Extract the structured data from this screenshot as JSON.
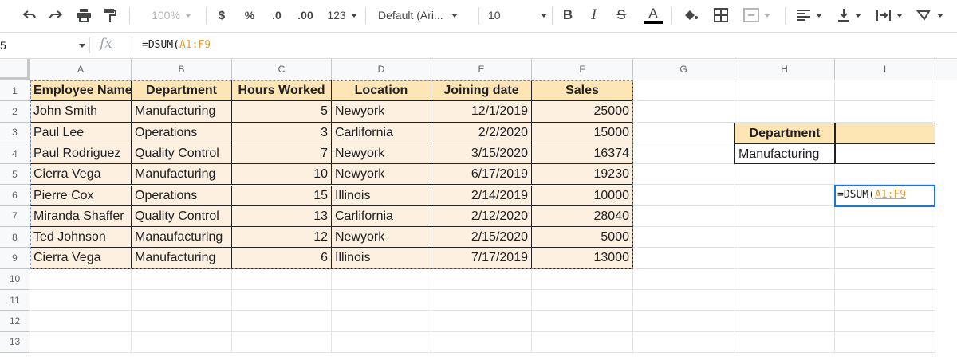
{
  "toolbar": {
    "undo_icon": "undo-icon",
    "redo_icon": "redo-icon",
    "print_icon": "print-icon",
    "paint_format_icon": "paint-format-icon",
    "zoom": "100%",
    "currency": "$",
    "percent": "%",
    "decrease_decimal": ".0",
    "increase_decimal": ".00",
    "more_formats": "123",
    "font_family": "Default (Ari...",
    "font_size": "10",
    "bold": "B",
    "italic": "I",
    "strikethrough": "S",
    "text_color": "A",
    "text_color_value": "#000000",
    "fill_color_icon": "fill-color-icon",
    "borders_icon": "borders-icon",
    "merge_icon": "merge-cells-icon",
    "align_icon": "horizontal-align-icon",
    "valign_icon": "vertical-align-icon",
    "wrap_icon": "text-wrap-icon",
    "rotate_icon": "text-rotation-icon"
  },
  "formula_bar": {
    "name_box": "5",
    "fx": "fx",
    "formula_prefix": "=DSUM(",
    "formula_ref": "A1:F9"
  },
  "columns": [
    "A",
    "B",
    "C",
    "D",
    "E",
    "F",
    "G",
    "H",
    "I"
  ],
  "rows": [
    "1",
    "2",
    "3",
    "4",
    "5",
    "6",
    "7",
    "8",
    "9",
    "10",
    "11",
    "12",
    "13"
  ],
  "table": {
    "headers": [
      "Employee Name",
      "Department",
      "Hours Worked",
      "Location",
      "Joining date",
      "Sales"
    ],
    "rows": [
      [
        "John Smith",
        "Manufacturing",
        "5",
        "Newyork",
        "12/1/2019",
        "25000"
      ],
      [
        "Paul Lee",
        "Operations",
        "3",
        "Carlifornia",
        "2/2/2020",
        "15000"
      ],
      [
        "Paul Rodriguez",
        "Quality Control",
        "7",
        "Newyork",
        "3/15/2020",
        "16374"
      ],
      [
        "Cierra Vega",
        "Manufacturing",
        "10",
        "Newyork",
        "6/17/2019",
        "19230"
      ],
      [
        "Pierre Cox",
        "Operations",
        "15",
        "Illinois",
        "2/14/2019",
        "10000"
      ],
      [
        "Miranda Shaffer",
        "Quality Control",
        "13",
        "Carlifornia",
        "2/12/2020",
        "28040"
      ],
      [
        "Ted Johnson",
        "Manaufacturing",
        "12",
        "Newyork",
        "2/15/2020",
        "5000"
      ],
      [
        "Cierra Vega",
        "Manufacturing",
        "6",
        "Illinois",
        "7/17/2019",
        "13000"
      ]
    ]
  },
  "criteria": {
    "header": "Department",
    "value": "Manufacturing"
  },
  "active_cell": {
    "prefix": "=DSUM(",
    "ref": "A1:F9"
  },
  "colors": {
    "header_fill": "#fde5b4",
    "body_fill": "#fdf0e0",
    "selection": "#1a73e8",
    "range_ref": "#e8a02f"
  }
}
